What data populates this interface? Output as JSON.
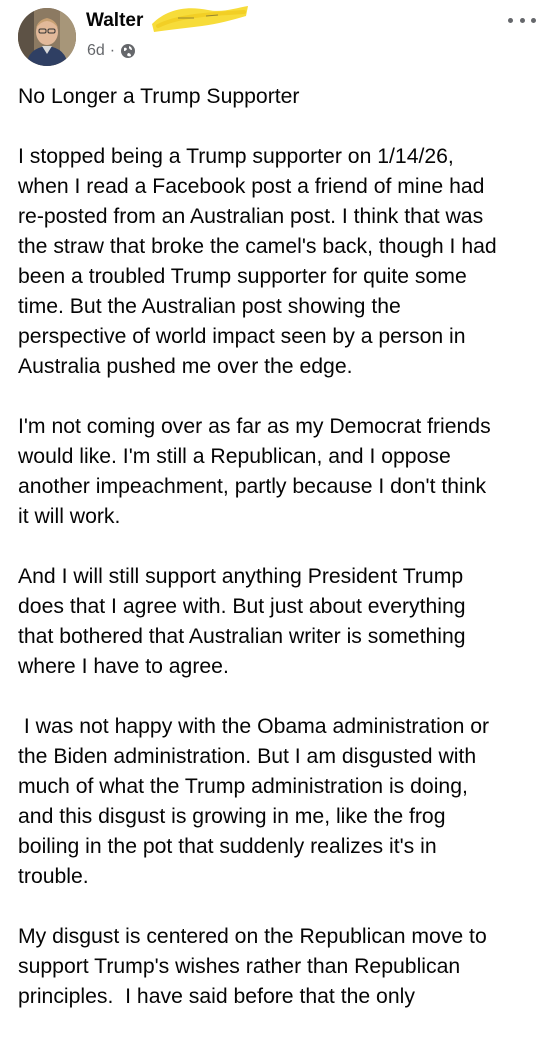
{
  "post": {
    "author": "Walter",
    "time": "6d",
    "separator": "·",
    "privacy_icon": "globe-icon",
    "more_icon": "more-options-icon",
    "title": "No Longer a Trump Supporter",
    "paragraphs": [
      "I stopped being a Trump supporter on 1/14/26,\nwhen I read a Facebook post a friend of mine had\nre-posted from an Australian post. I think that was\nthe straw that broke the camel's back, though I had\nbeen a troubled Trump supporter for quite some\ntime. But the Australian post showing the\nperspective of world impact seen by a person in\nAustralia pushed me over the edge.",
      "I'm not coming over as far as my Democrat friends\nwould like. I'm still a Republican, and I oppose\nanother impeachment, partly because I don't think\nit will work.",
      "And I will still support anything President Trump\ndoes that I agree with. But just about everything\nthat bothered that Australian writer is something\nwhere I have to agree.",
      " I was not happy with the Obama administration or\nthe Biden administration. But I am disgusted with\nmuch of what the Trump administration is doing,\nand this disgust is growing in me, like the frog\nboiling in the pot that suddenly realizes it's in\ntrouble.",
      "My disgust is centered on the Republican move to\nsupport Trump's wishes rather than Republican\nprinciples.  I have said before that the only"
    ]
  },
  "colors": {
    "text": "#050505",
    "secondary_text": "#65676b",
    "redaction": "#f7dc3a"
  }
}
